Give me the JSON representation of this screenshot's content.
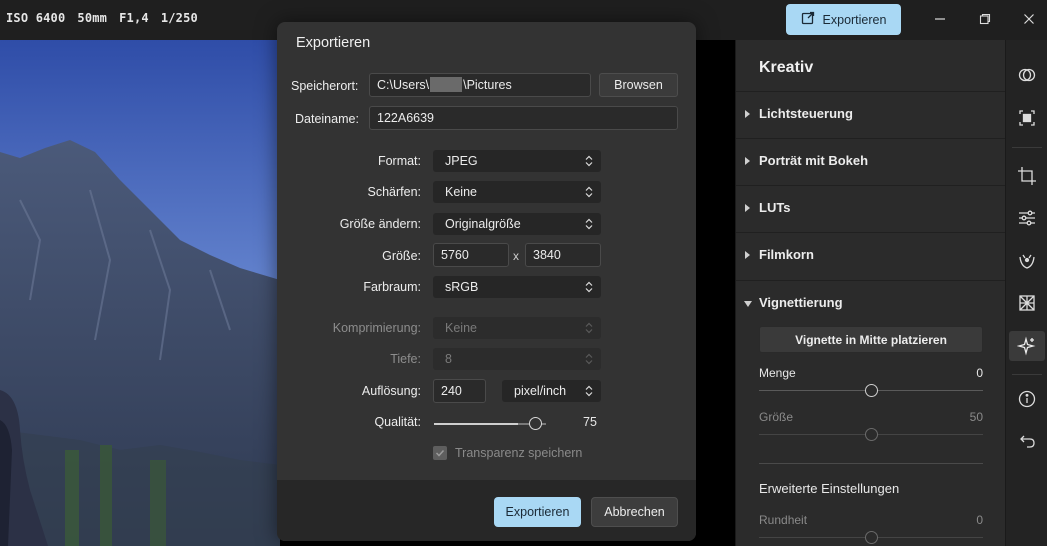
{
  "topbar": {
    "exif": {
      "iso": "ISO 6400",
      "focal": "50mm",
      "aperture": "F1,4",
      "shutter": "1/250"
    },
    "export_label": "Exportieren"
  },
  "panel": {
    "title": "Kreativ",
    "sections": [
      {
        "label": "Lichtsteuerung",
        "expanded": false
      },
      {
        "label": "Porträt mit Bokeh",
        "expanded": false
      },
      {
        "label": "LUTs",
        "expanded": false
      },
      {
        "label": "Filmkorn",
        "expanded": false
      },
      {
        "label": "Vignettierung",
        "expanded": true
      }
    ],
    "vignette_button": "Vignette in Mitte platzieren",
    "sliders": [
      {
        "label": "Menge",
        "value": "0",
        "level": 0.5,
        "enabled": true
      },
      {
        "label": "Größe",
        "value": "50",
        "level": 0.5,
        "enabled": false
      }
    ],
    "advanced_label": "Erweiterte Einstellungen",
    "advanced_sliders": [
      {
        "label": "Rundheit",
        "value": "0",
        "level": 0.5,
        "enabled": false
      }
    ]
  },
  "rail": {
    "icons": [
      "layers-icon",
      "select-subject-icon",
      "crop-icon",
      "adjustments-icon",
      "heal-icon",
      "grid-icon",
      "sparkle-icon",
      "info-icon",
      "undo-icon"
    ],
    "selected": "sparkle-icon"
  },
  "dialog": {
    "title": "Exportieren",
    "location_label": "Speicherort:",
    "location_prefix": "C:\\Users\\",
    "location_suffix": "\\Pictures",
    "browse_label": "Browsen",
    "filename_label": "Dateiname:",
    "filename_value": "122A6639",
    "format_label": "Format:",
    "format_value": "JPEG",
    "sharpen_label": "Schärfen:",
    "sharpen_value": "Keine",
    "resize_label": "Größe ändern:",
    "resize_value": "Originalgröße",
    "size_label": "Größe:",
    "width_value": "5760",
    "times": "x",
    "height_value": "3840",
    "colorspace_label": "Farbraum:",
    "colorspace_value": "sRGB",
    "compression_label": "Komprimierung:",
    "compression_value": "Keine",
    "depth_label": "Tiefe:",
    "depth_value": "8",
    "resolution_label": "Auflösung:",
    "resolution_value": "240",
    "resolution_unit": "pixel/inch",
    "quality_label": "Qualität:",
    "quality_value": "75",
    "quality_level": 0.75,
    "transparency_label": "Transparenz speichern",
    "transparency_checked": true,
    "export_button": "Exportieren",
    "cancel_button": "Abbrechen"
  }
}
